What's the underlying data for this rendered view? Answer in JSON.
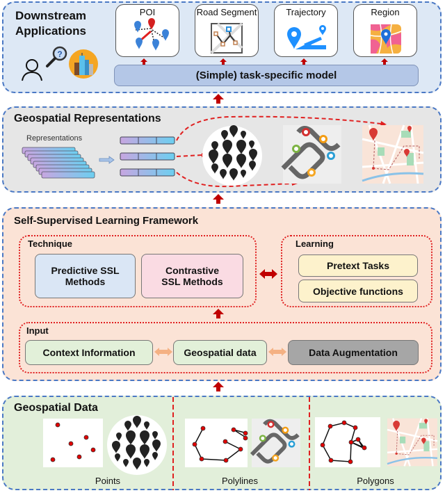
{
  "downstream": {
    "title_line1": "Downstream",
    "title_line2": "Applications",
    "apps": [
      {
        "label": "POI",
        "icon": "poi-network-icon"
      },
      {
        "label": "Road Segment",
        "icon": "road-segment-icon"
      },
      {
        "label": "Trajectory",
        "icon": "trajectory-icon"
      },
      {
        "label": "Region",
        "icon": "region-map-icon"
      }
    ],
    "model_label": "(Simple) task-specific model"
  },
  "representations": {
    "title": "Geospatial Representations",
    "stack_label": "Representations"
  },
  "ssl": {
    "title": "Self-Supervised Learning Framework",
    "technique": {
      "label": "Technique",
      "predictive": "Predictive SSL Methods",
      "contrastive": "Contrastive SSL Methods"
    },
    "learning": {
      "label": "Learning",
      "items": [
        "Pretext Tasks",
        "Objective functions"
      ]
    },
    "input": {
      "label": "Input",
      "items": [
        "Context Information",
        "Geospatial data",
        "Data Augmentation"
      ]
    }
  },
  "geodata": {
    "title": "Geospatial Data",
    "captions": [
      "Points",
      "Polylines",
      "Polygons"
    ]
  },
  "colors": {
    "panel_border": "#4a78c4",
    "downstream_bg": "#dde8f5",
    "representations_bg": "#e6e6e6",
    "ssl_bg": "#fbe3d6",
    "geodata_bg": "#e2efda",
    "arrow_red": "#c00000",
    "predictive_bg": "#dae6f5",
    "contrastive_bg": "#fadbe3",
    "learning_item_bg": "#fdf2cc",
    "input_item_bg": "#e2f0d9",
    "augmentation_bg": "#a6a6a6"
  }
}
